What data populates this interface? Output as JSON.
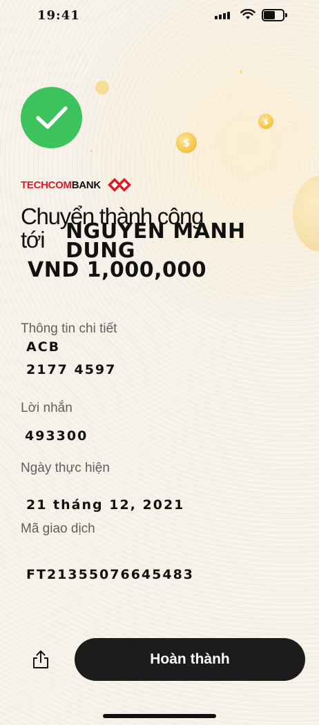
{
  "status_bar": {
    "time": "19:41"
  },
  "brand": {
    "name_part1": "TECHCOM",
    "name_part2": "BANK",
    "color_red": "#e01a22"
  },
  "success": {
    "icon": "checkmark-icon",
    "color": "#3cc35d"
  },
  "transfer": {
    "headline_line1": "Chuyển thành công",
    "headline_line2": "tới",
    "recipient_name": "NGUYEN MANH DUNG",
    "amount": "VND 1,000,000"
  },
  "details": {
    "info_label": "Thông tin chi tiết",
    "bank": "ACB",
    "account_number": "2177 4597",
    "message_label": "Lời nhắn",
    "message": "493300",
    "date_label": "Ngày thực hiện",
    "date": "21 tháng 12, 2021",
    "transaction_label": "Mã giao dịch",
    "transaction_id": "FT21355076645483"
  },
  "actions": {
    "share_icon": "share-icon",
    "done_label": "Hoàn thành"
  },
  "decor": {
    "coin_symbol": "$"
  }
}
